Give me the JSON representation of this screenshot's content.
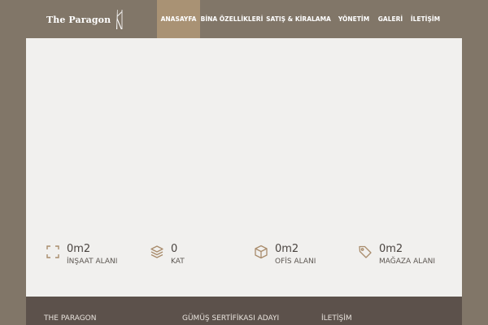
{
  "brand": {
    "name": "The Paragon",
    "logo_icon": "paragon-tower-mark"
  },
  "nav": {
    "items": [
      {
        "label": "ANASAYFA",
        "active": true
      },
      {
        "label": "BİNA ÖZELLİKLERİ",
        "active": false
      },
      {
        "label": "SATIŞ & KİRALAMA",
        "active": false
      },
      {
        "label": "YÖNETİM",
        "active": false
      },
      {
        "label": "GALERİ",
        "active": false
      },
      {
        "label": "İLETİŞİM",
        "active": false
      }
    ]
  },
  "stats": [
    {
      "icon": "expand-corners-icon",
      "value": "0m2",
      "label": "İNŞAAT ALANI"
    },
    {
      "icon": "layers-icon",
      "value": "0",
      "label": "KAT"
    },
    {
      "icon": "box-icon",
      "value": "0m2",
      "label": "OFİS ALANI"
    },
    {
      "icon": "tag-icon",
      "value": "0m2",
      "label": "MAĞAZA ALANI"
    }
  ],
  "footer": {
    "headings": [
      "THE PARAGON",
      "GÜMÜŞ SERTİFİKASI ADAYI",
      "İLETİŞİM"
    ]
  },
  "colors": {
    "background": "#817668",
    "nav_active": "#a99274",
    "stage": "#f1f0ee",
    "icon_accent": "#a98c6c",
    "footer": "#5c514b"
  }
}
